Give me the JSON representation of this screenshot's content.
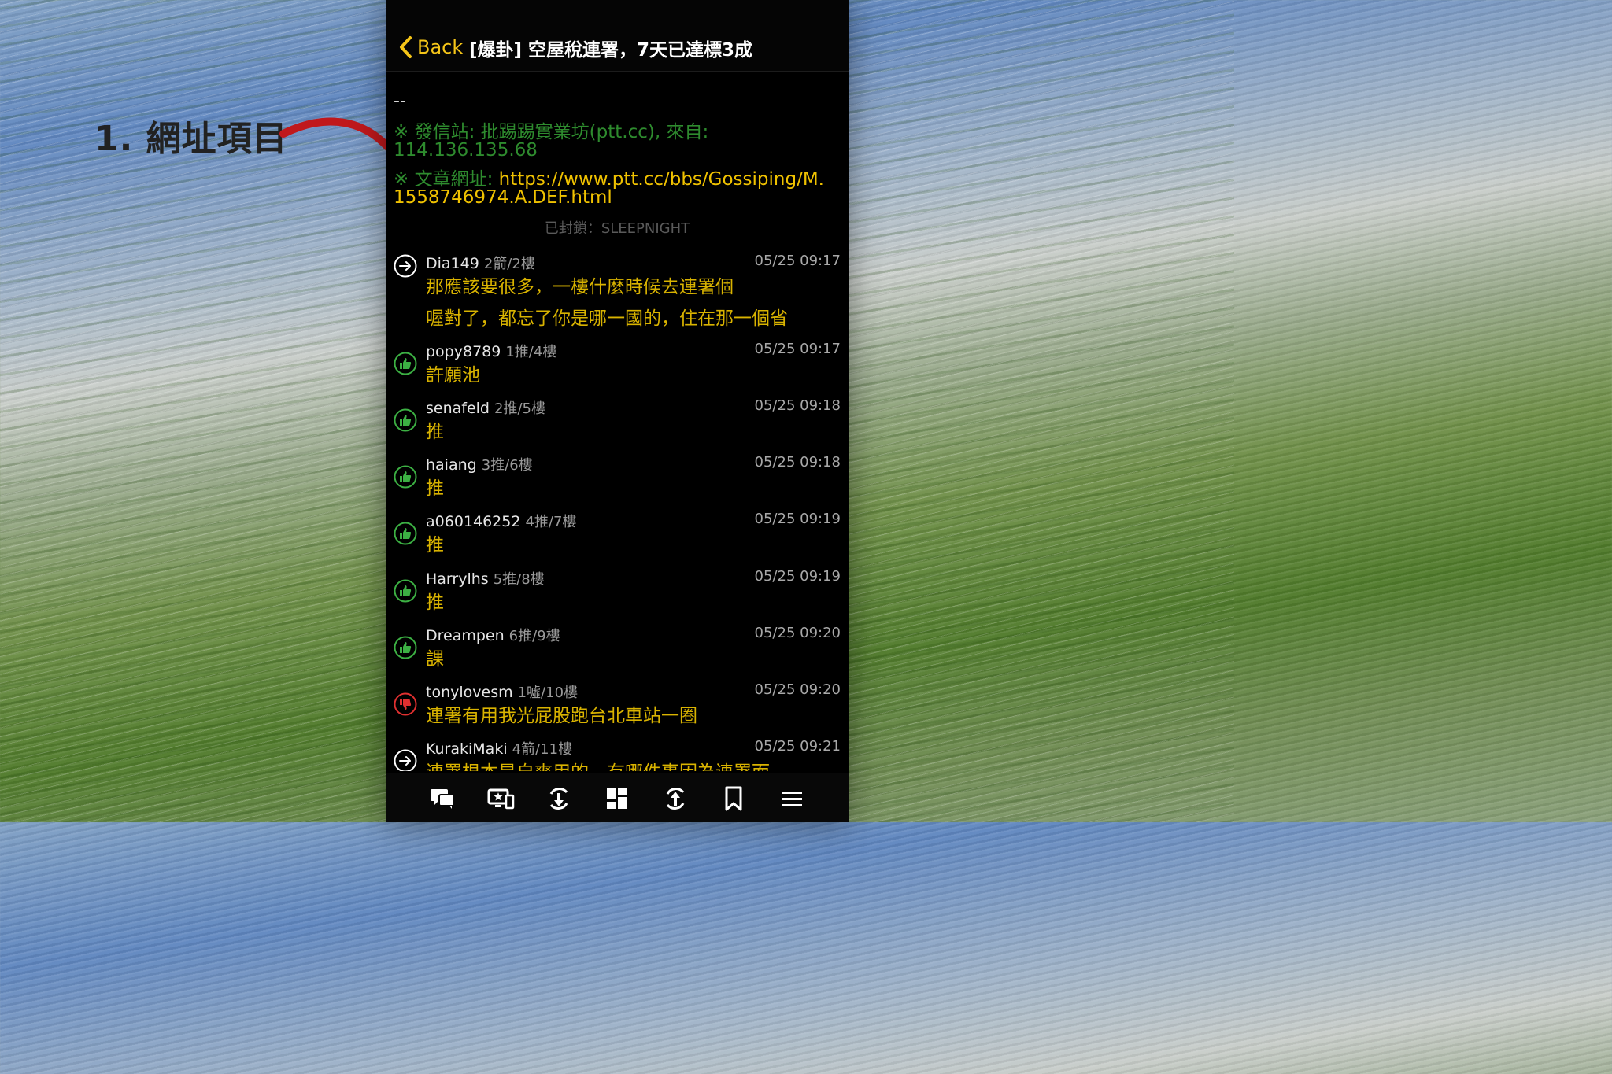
{
  "annotation": {
    "label": "1. 網址項目"
  },
  "nav": {
    "back_label": "Back",
    "title": "[爆卦] 空屋稅連署，7天已達標3成"
  },
  "signature": {
    "dash": "--",
    "line1": "※ 發信站: 批踢踢實業坊(ptt.cc), 來自:",
    "line2": "114.136.135.68",
    "line3_prefix": "※ 文章網址: ",
    "url_part1": "https://www.ptt.cc/bbs/Gossiping/M.",
    "url_part2": "1558746974.A.DEF.html"
  },
  "blocked": "已封鎖：SLEEPNIGHT",
  "comments": [
    {
      "type": "arrow",
      "user": "Dia149",
      "floor": "2箭/2樓",
      "time": "05/25 09:17",
      "lines": [
        "那應該要很多，一樓什麼時候去連署個",
        "喔對了，都忘了你是哪一國的，住在那一個省"
      ]
    },
    {
      "type": "push",
      "user": "popy8789",
      "floor": "1推/4樓",
      "time": "05/25 09:17",
      "lines": [
        "許願池"
      ]
    },
    {
      "type": "push",
      "user": "senafeld",
      "floor": "2推/5樓",
      "time": "05/25 09:18",
      "lines": [
        "推"
      ]
    },
    {
      "type": "push",
      "user": "haiang",
      "floor": "3推/6樓",
      "time": "05/25 09:18",
      "lines": [
        "推"
      ]
    },
    {
      "type": "push",
      "user": "a060146252",
      "floor": "4推/7樓",
      "time": "05/25 09:19",
      "lines": [
        "推"
      ]
    },
    {
      "type": "push",
      "user": "Harrylhs",
      "floor": "5推/8樓",
      "time": "05/25 09:19",
      "lines": [
        "推"
      ]
    },
    {
      "type": "push",
      "user": "Dreampen",
      "floor": "6推/9樓",
      "time": "05/25 09:20",
      "lines": [
        "課"
      ]
    },
    {
      "type": "boo",
      "user": "tonylovesm",
      "floor": "1噓/10樓",
      "time": "05/25 09:20",
      "lines": [
        "連署有用我光屁股跑台北車站一圈"
      ]
    },
    {
      "type": "arrow",
      "user": "KurakiMaki",
      "floor": "4箭/11樓",
      "time": "05/25 09:21",
      "lines": [
        "連署根本是自爽用的，有哪件事因為連署而"
      ]
    }
  ],
  "colors": {
    "accent": "#f5c518",
    "push": "#3cb043",
    "boo": "#e03030",
    "signature": "#2e8b2e",
    "comment_text": "#d9b300"
  },
  "tabbar": [
    {
      "icon": "comment-icon"
    },
    {
      "icon": "screen-star-icon"
    },
    {
      "icon": "refresh-down-icon"
    },
    {
      "icon": "grid-icon"
    },
    {
      "icon": "refresh-up-icon"
    },
    {
      "icon": "bookmark-icon"
    },
    {
      "icon": "menu-icon"
    }
  ]
}
